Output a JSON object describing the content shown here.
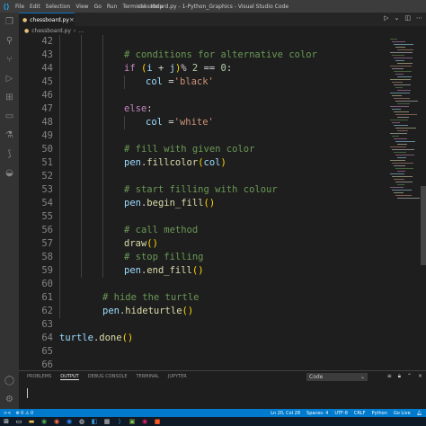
{
  "titlebar": {
    "menu": [
      "File",
      "Edit",
      "Selection",
      "View",
      "Go",
      "Run",
      "Terminal",
      "Help"
    ],
    "title": "chessboard.py - 1-Python_Graphics - Visual Studio Code"
  },
  "tab": {
    "label": "chessboard.py",
    "close": "×"
  },
  "breadcrumb": {
    "label": "chessboard.py",
    "sep": "›",
    "more": "..."
  },
  "code_lines": [
    {
      "n": "42",
      "y": 0
    },
    {
      "n": "43",
      "y": 1
    },
    {
      "n": "44",
      "y": 2
    },
    {
      "n": "45",
      "y": 3
    },
    {
      "n": "46",
      "y": 4
    },
    {
      "n": "47",
      "y": 5
    },
    {
      "n": "48",
      "y": 6
    },
    {
      "n": "49",
      "y": 7
    },
    {
      "n": "50",
      "y": 8
    },
    {
      "n": "51",
      "y": 9
    },
    {
      "n": "52",
      "y": 10
    },
    {
      "n": "53",
      "y": 11
    },
    {
      "n": "54",
      "y": 12
    },
    {
      "n": "55",
      "y": 13
    },
    {
      "n": "56",
      "y": 14
    },
    {
      "n": "57",
      "y": 15
    },
    {
      "n": "58",
      "y": 16
    },
    {
      "n": "59",
      "y": 17
    },
    {
      "n": "60",
      "y": 18
    },
    {
      "n": "61",
      "y": 19
    },
    {
      "n": "62",
      "y": 20
    },
    {
      "n": "63",
      "y": 21
    },
    {
      "n": "64",
      "y": 22
    },
    {
      "n": "65",
      "y": 23
    },
    {
      "n": "66",
      "y": 24
    },
    {
      "n": "67",
      "y": 25
    }
  ],
  "code": {
    "c43": "# conditions for alternative color",
    "l44_if": "if",
    "l44_p": "(",
    "l44_i": "i",
    "l44_plus": " + ",
    "l44_j": "j",
    "l44_pc": ")",
    "l44_mod": "% ",
    "l44_2": "2",
    "l44_eq": " == ",
    "l44_0": "0",
    "l44_col": ":",
    "l45_col": "col",
    "l45_eq": " =",
    "l45_str": "'black'",
    "l47_else": "else",
    "l47_colon": ":",
    "l48_col": "col",
    "l48_eq": " =",
    "l48_str": "'white'",
    "c50": "# fill with given color",
    "l51_pen": "pen",
    "l51_dot": ".",
    "l51_fn": "fillcolor",
    "l51_p": "(",
    "l51_arg": "col",
    "l51_pc": ")",
    "c53": "# start filling with colour",
    "l54_pen": "pen",
    "l54_dot": ".",
    "l54_fn": "begin_fill",
    "l54_p": "()",
    "c56": "# call method",
    "l57_fn": "draw",
    "l57_p": "()",
    "c58": "# stop filling",
    "l59_pen": "pen",
    "l59_dot": ".",
    "l59_fn": "end_fill",
    "l59_p": "()",
    "c61": "# hide the turtle",
    "l62_pen": "pen",
    "l62_dot": ".",
    "l62_fn": "hideturtle",
    "l62_p": "()",
    "l64_t": "turtle",
    "l64_dot": ".",
    "l64_fn": "done",
    "l64_p": "()"
  },
  "panel": {
    "tabs": [
      "PROBLEMS",
      "OUTPUT",
      "DEBUG CONSOLE",
      "TERMINAL",
      "JUPYTER"
    ],
    "select_value": "Code"
  },
  "status": {
    "remote": "><",
    "errors": "⊗ 0  ⚠ 0",
    "position": "Ln 20, Col 28",
    "spaces": "Spaces: 4",
    "encoding": "UTF-8",
    "eol": "CRLF",
    "language": "Python",
    "golive": "Go Live"
  },
  "colors": {
    "accent": "#007acc",
    "keyword": "#c586c0",
    "comment": "#6a9955",
    "function": "#dcdcaa",
    "variable": "#9cdcfe",
    "string": "#ce9178",
    "number": "#b5cea8"
  }
}
